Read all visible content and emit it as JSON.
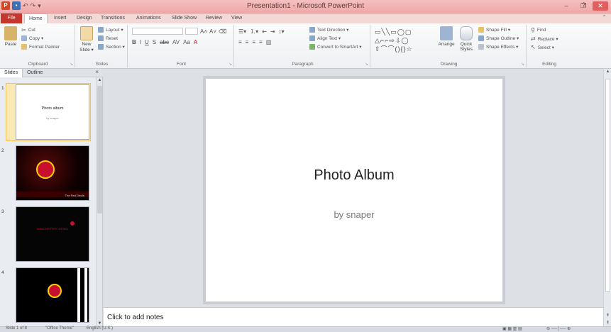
{
  "window": {
    "title": "Presentation1 - Microsoft PowerPoint",
    "minimize": "–",
    "maximize": "❐",
    "close": "✕",
    "help": "?"
  },
  "tabs": [
    "File",
    "Home",
    "Insert",
    "Design",
    "Transitions",
    "Animations",
    "Slide Show",
    "Review",
    "View"
  ],
  "ribbon": {
    "clipboard": {
      "label": "Clipboard",
      "paste": "Paste",
      "cut": "Cut",
      "copy": "Copy ▾",
      "format_painter": "Format Painter"
    },
    "slides": {
      "label": "Slides",
      "new_slide": "New Slide ▾",
      "layout": "Layout ▾",
      "reset": "Reset",
      "section": "Section ▾"
    },
    "font": {
      "label": "Font",
      "bold": "B",
      "italic": "I",
      "underline": "U",
      "strike": "S",
      "abc": "abc",
      "spacing": "AV",
      "case": "Aa",
      "color": "A"
    },
    "paragraph": {
      "label": "Paragraph",
      "text_direction": "Text Direction ▾",
      "align_text": "Align Text ▾",
      "convert_smartart": "Convert to SmartArt ▾"
    },
    "drawing": {
      "label": "Drawing",
      "arrange": "Arrange",
      "quick_styles": "Quick Styles",
      "shape_fill": "Shape Fill ▾",
      "shape_outline": "Shape Outline ▾",
      "shape_effects": "Shape Effects ▾"
    },
    "editing": {
      "label": "Editing",
      "find": "Find",
      "replace": "Replace ▾",
      "select": "Select ▾"
    }
  },
  "pane": {
    "tab_slides": "Slides",
    "tab_outline": "Outline",
    "close": "×",
    "thumbs": [
      {
        "num": "1",
        "title": "Photo album",
        "sub": "by snaper"
      },
      {
        "num": "2",
        "caption": "The Red Devils"
      },
      {
        "num": "3",
        "caption": "MANCHESTER UNITED"
      },
      {
        "num": "4"
      }
    ]
  },
  "slide": {
    "title": "Photo Album",
    "subtitle": "by snaper"
  },
  "notes": {
    "placeholder": "Click to add notes"
  },
  "status": {
    "slide": "Slide 1 of 8",
    "theme": "\"Office Theme\"",
    "language": "English (U.S.)"
  }
}
